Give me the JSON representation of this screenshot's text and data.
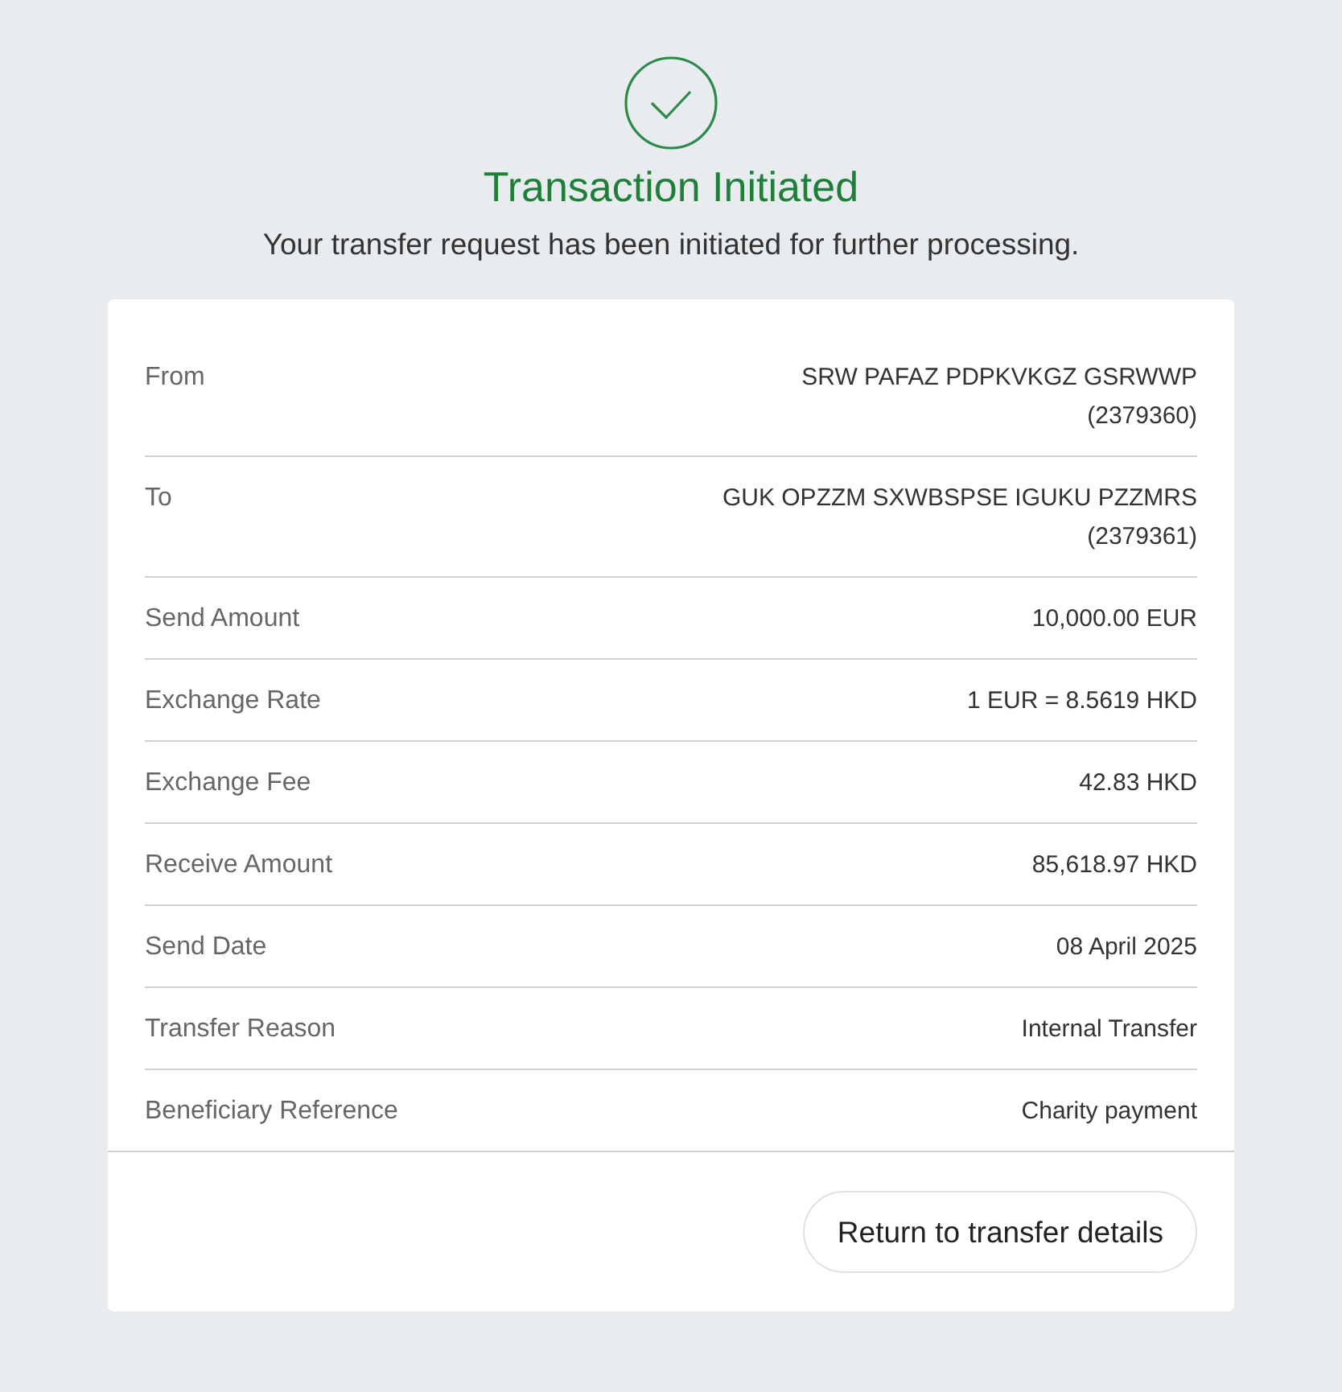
{
  "header": {
    "title": "Transaction Initiated",
    "message": "Your transfer request has been initiated for further processing."
  },
  "details": [
    {
      "label": "From",
      "value_lines": [
        "SRW PAFAZ PDPKVKGZ GSRWWP",
        "(2379360)"
      ]
    },
    {
      "label": "To",
      "value_lines": [
        "GUK OPZZM SXWBSPSE IGUKU PZZMRS",
        "(2379361)"
      ]
    },
    {
      "label": "Send Amount",
      "value_lines": [
        "10,000.00 EUR"
      ]
    },
    {
      "label": "Exchange Rate",
      "value_lines": [
        "1 EUR = 8.5619 HKD"
      ]
    },
    {
      "label": "Exchange Fee",
      "value_lines": [
        "42.83 HKD"
      ]
    },
    {
      "label": "Receive Amount",
      "value_lines": [
        "85,618.97 HKD"
      ]
    },
    {
      "label": "Send Date",
      "value_lines": [
        "08 April 2025"
      ]
    },
    {
      "label": "Transfer Reason",
      "value_lines": [
        "Internal Transfer"
      ]
    },
    {
      "label": "Beneficiary Reference",
      "value_lines": [
        "Charity payment"
      ]
    }
  ],
  "footer": {
    "button": "Return to transfer details"
  }
}
